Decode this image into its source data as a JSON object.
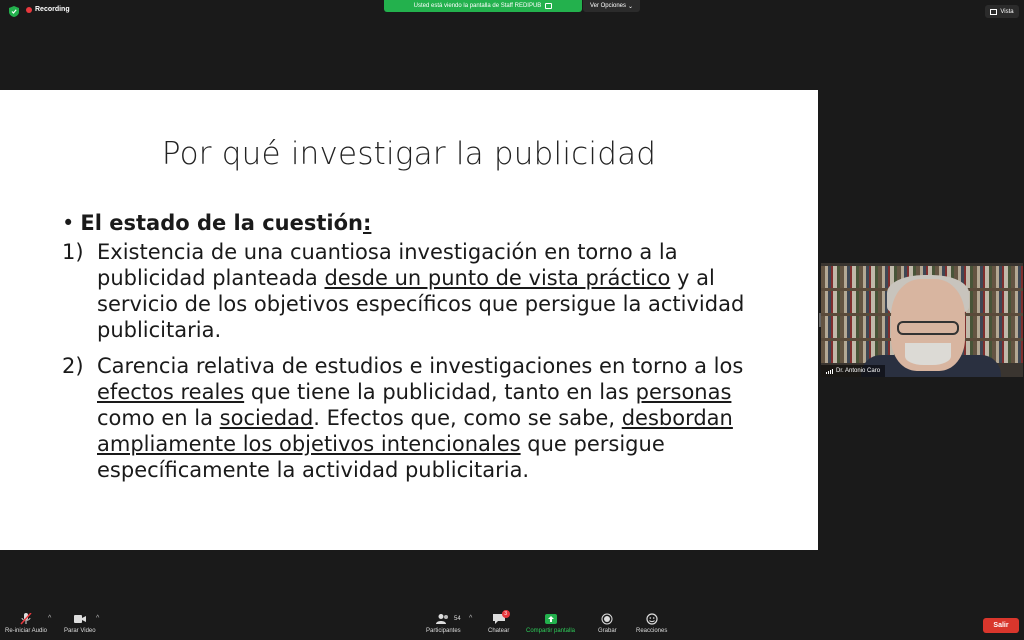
{
  "topbar": {
    "recording_label": "Recording",
    "share_banner": "Usted está viendo la pantalla de Staff REDIPUB",
    "view_options": "Ver Opciones",
    "vista": "Vista"
  },
  "slide": {
    "title": "Por qué investigar la publicidad",
    "bullet_head": "El estado de la cuestión",
    "bullet_colon": ":",
    "item1": {
      "num": "1)",
      "pre": "Existencia de una cuantiosa investigación en torno a la publicidad planteada ",
      "u1": "desde un punto de vista práctico",
      "post": " y al servicio de los objetivos específicos que persigue la actividad publicitaria."
    },
    "item2": {
      "num": "2)",
      "t1": "Carencia relativa de estudios e investigaciones en torno a los ",
      "u1": "efectos reales",
      "t2": " que tiene la publicidad, tanto en las ",
      "u2": "personas",
      "t3": " como en la ",
      "u3": "sociedad",
      "t4": ". Efectos que, como se sabe, ",
      "u4": "desbordan ampliamente los objetivos intencionales",
      "t5": " que persigue específicamente la actividad publicitaria."
    }
  },
  "video": {
    "participant_name": "Dr. Antonio Caro"
  },
  "toolbar": {
    "audio_label": "Re-iniciar Audio",
    "video_label": "Parar Video",
    "participants_label": "Participantes",
    "participants_count": "54",
    "chat_label": "Chatear",
    "chat_badge": "3",
    "share_label": "Compartir pantalla",
    "record_label": "Grabar",
    "reactions_label": "Reacciones",
    "leave_label": "Salir"
  },
  "colors": {
    "share_green": "#23b14d",
    "leave_red": "#d9362c",
    "recording_red": "#e8383d"
  }
}
